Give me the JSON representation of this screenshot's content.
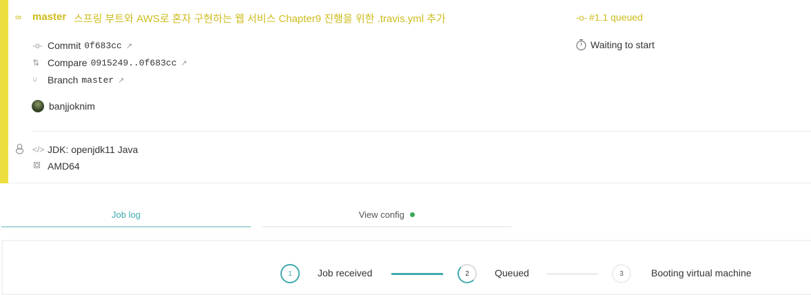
{
  "build": {
    "branch": "master",
    "message": "스프링 부트와 AWS로 혼자 구현하는 웹 서비스 Chapter9 진행을 위한 .travis.yml 추가",
    "job_number": "#1.1 queued",
    "status_text": "Waiting to start",
    "commit_label": "Commit",
    "commit_sha": "0f683cc",
    "compare_label": "Compare",
    "compare_range": "0915249..0f683cc",
    "branch_label": "Branch",
    "branch_name": "master",
    "author": "banjjoknim",
    "jdk": "JDK: openjdk11 Java",
    "arch": "AMD64"
  },
  "tabs": [
    {
      "label": "Job log",
      "active": true
    },
    {
      "label": "View config",
      "active": false,
      "status_dot_color": "#39aa56"
    }
  ],
  "progress": {
    "steps": [
      {
        "number": "1",
        "label": "Job received",
        "state": "done"
      },
      {
        "number": "2",
        "label": "Queued",
        "state": "active"
      },
      {
        "number": "3",
        "label": "Booting virtual machine",
        "state": "pending"
      }
    ]
  },
  "colors": {
    "queued_yellow": "#cdbc1c",
    "stripe_yellow": "#edde3f",
    "teal": "#3eaaaf",
    "success_green": "#39aa56"
  }
}
